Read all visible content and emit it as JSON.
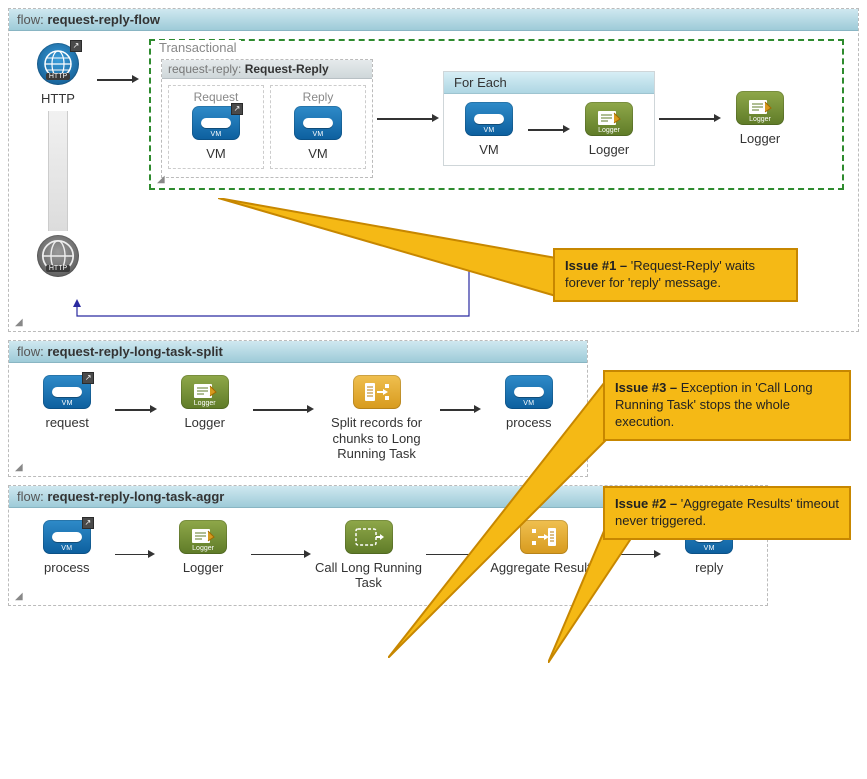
{
  "flow1": {
    "prefix": "flow: ",
    "name": "request-reply-flow",
    "http_label": "HTTP",
    "transactional_title": "Transactional",
    "rr_prefix": "request-reply: ",
    "rr_name": "Request-Reply",
    "rr_request": "Request",
    "rr_reply": "Reply",
    "vm_label": "VM",
    "foreach_title": "For Each",
    "logger_label": "Logger"
  },
  "flow2": {
    "prefix": "flow: ",
    "name": "request-reply-long-task-split",
    "n1": "request",
    "n2": "Logger",
    "n3": "Split records for chunks to Long Running Task",
    "n4": "process"
  },
  "flow3": {
    "prefix": "flow: ",
    "name": "request-reply-long-task-aggr",
    "n1": "process",
    "n2": "Logger",
    "n3": "Call Long Running Task",
    "n4": "Aggregate Results",
    "n5": "reply"
  },
  "callouts": {
    "c1_prefix": "Issue #1 – ",
    "c1_text": "'Request-Reply' waits forever for 'reply' message.",
    "c2_prefix": "Issue #2 – ",
    "c2_text": "'Aggregate Results' timeout never triggered.",
    "c3_prefix": "Issue #3 – ",
    "c3_text": "Exception in 'Call Long Running Task' stops the whole execution."
  }
}
